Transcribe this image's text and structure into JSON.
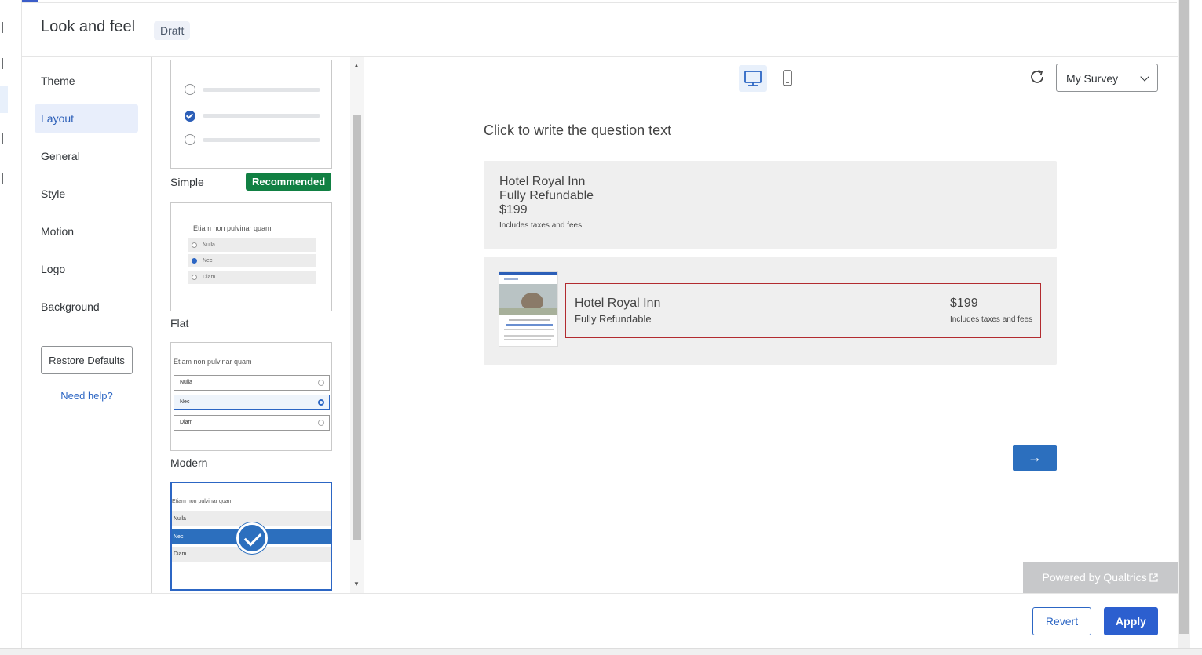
{
  "header": {
    "title": "Look and feel",
    "status_badge": "Draft"
  },
  "nav": {
    "items": [
      {
        "label": "Theme"
      },
      {
        "label": "Layout",
        "active": true
      },
      {
        "label": "General"
      },
      {
        "label": "Style"
      },
      {
        "label": "Motion"
      },
      {
        "label": "Logo"
      },
      {
        "label": "Background"
      }
    ],
    "restore_label": "Restore Defaults",
    "help_label": "Need help?"
  },
  "layouts": {
    "simple": {
      "label": "Simple",
      "badge": "Recommended"
    },
    "flat": {
      "label": "Flat",
      "question": "Etiam non pulvinar quam",
      "options": [
        "Nulla",
        "Nec",
        "Diam"
      ]
    },
    "modern": {
      "label": "Modern",
      "question": "Etiam non pulvinar quam",
      "options": [
        "Nulla",
        "Nec",
        "Diam"
      ]
    },
    "classic": {
      "question": "Etiam non pulvinar quam",
      "options": [
        "Nulla",
        "Nec",
        "Diam"
      ],
      "selected": true
    }
  },
  "preview": {
    "survey_select": "My Survey",
    "question_text": "Click to write the question text",
    "option1": {
      "line1": "Hotel Royal Inn",
      "line2": "Fully Refundable",
      "line3": "$199",
      "note": "Includes taxes and fees"
    },
    "option2": {
      "name": "Hotel Royal Inn",
      "refund": "Fully Refundable",
      "price": "$199",
      "note": "Includes taxes and fees"
    },
    "next_label": "→",
    "powered_by": "Powered by Qualtrics"
  },
  "footer": {
    "revert_label": "Revert",
    "apply_label": "Apply"
  },
  "colors": {
    "accent": "#2c66c4",
    "recommended": "#118043",
    "selected_outline": "#b22b2f"
  }
}
